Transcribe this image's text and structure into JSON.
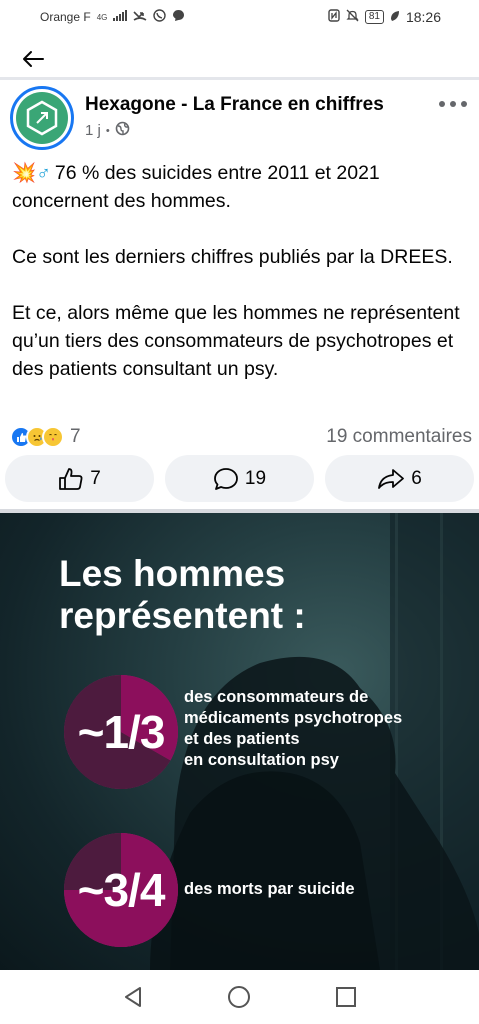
{
  "status_bar": {
    "carrier": "Orange F",
    "network": "4G",
    "battery": "81",
    "time": "18:26"
  },
  "post": {
    "page_name": "Hexagone - La France en chiffres",
    "time_ago": "1 j",
    "separator": "•",
    "paragraphs": [
      "76 % des suicides entre 2011 et 2021 concernent des hommes.",
      "Ce sont les derniers chiffres publiés par la DREES.",
      "Et ce, alors même que les hommes ne représentent qu’un tiers des consommateurs de psychotropes et des patients consultant un psy."
    ],
    "emoji_prefix_1": "💥",
    "emoji_prefix_2": "♂",
    "reaction_count": "7",
    "comments_label": "19 commentaires",
    "like_count": "7",
    "comment_count": "19",
    "share_count": "6"
  },
  "infographic": {
    "title_line1": "Les hommes",
    "title_line2": "représentent :",
    "stats": [
      {
        "value": "~1/3",
        "fraction": 0.333,
        "desc_lines": [
          "des consommateurs de",
          "médicaments psychotropes",
          "et des patients",
          "en consultation psy"
        ]
      },
      {
        "value": "~3/4",
        "fraction": 0.75,
        "desc_lines": [
          "des morts par suicide"
        ]
      }
    ],
    "colors": {
      "accent": "#8c0f5c",
      "accent_light": "#a72674",
      "background": "#1d3438"
    }
  },
  "icons": {
    "back": "arrow-left-icon",
    "more": "more-horizontal-icon",
    "globe": "globe-icon",
    "like": "thumbs-up-icon",
    "comment": "comment-icon",
    "share": "share-icon"
  }
}
